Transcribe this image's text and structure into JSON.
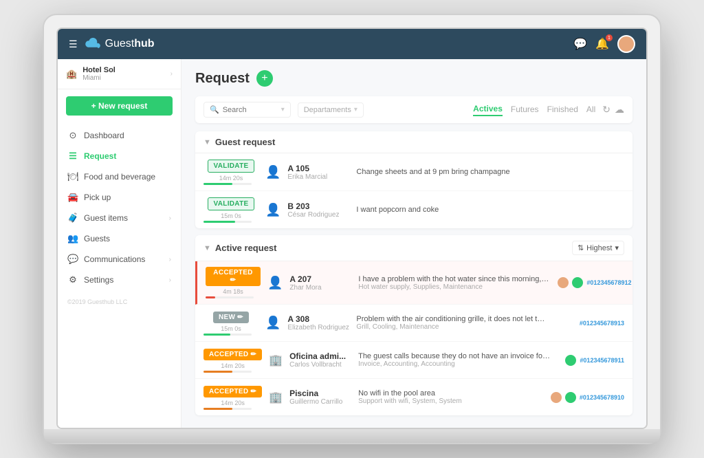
{
  "app": {
    "name": "Guesthub",
    "brand_first": "Guest",
    "brand_second": "hub"
  },
  "hotel": {
    "name": "Hotel Sol",
    "location": "Miami"
  },
  "sidebar": {
    "new_request": "+ New request",
    "nav": [
      {
        "label": "Dashboard",
        "icon": "⊙",
        "active": false,
        "has_chevron": false
      },
      {
        "label": "Request",
        "icon": "☰",
        "active": true,
        "has_chevron": false
      },
      {
        "label": "Food and beverage",
        "icon": "🍽",
        "active": false,
        "has_chevron": false
      },
      {
        "label": "Pick up",
        "icon": "🚗",
        "active": false,
        "has_chevron": false
      },
      {
        "label": "Guest items",
        "icon": "🧳",
        "active": false,
        "has_chevron": true
      },
      {
        "label": "Guests",
        "icon": "👥",
        "active": false,
        "has_chevron": false
      },
      {
        "label": "Communications",
        "icon": "💬",
        "active": false,
        "has_chevron": true
      },
      {
        "label": "Settings",
        "icon": "⚙",
        "active": false,
        "has_chevron": true
      }
    ],
    "footer": "©2019 Guesthub LLC"
  },
  "content": {
    "title": "Request",
    "filter": {
      "search_placeholder": "Search",
      "department_placeholder": "Departaments",
      "tabs": [
        {
          "label": "Actives",
          "active": true
        },
        {
          "label": "Futures",
          "active": false
        },
        {
          "label": "Finished",
          "active": false
        },
        {
          "label": "All",
          "active": false
        }
      ]
    },
    "guest_section": {
      "title": "Guest request",
      "requests": [
        {
          "badge": "VALIDATE",
          "badge_type": "validate",
          "timer": "14m 20s",
          "progress": 60,
          "progress_color": "fill-green",
          "room": "A 105",
          "name": "Erika Marcial",
          "icon_type": "person",
          "description": "Change sheets and at 9 pm bring champagne",
          "sub_desc": ""
        },
        {
          "badge": "VALIDATE",
          "badge_type": "validate",
          "timer": "15m 0s",
          "progress": 65,
          "progress_color": "fill-green",
          "room": "B 203",
          "name": "César Rodriguez",
          "icon_type": "person",
          "description": "I want popcorn and coke",
          "sub_desc": ""
        }
      ]
    },
    "active_section": {
      "title": "Active request",
      "sort_label": "Highest",
      "requests": [
        {
          "badge": "ACCEPTED ✏",
          "badge_type": "accepted",
          "timer": "4m 18s",
          "progress": 20,
          "progress_color": "fill-red",
          "room": "A 207",
          "name": "Zhar Mora",
          "icon_type": "person",
          "description": "I have a problem with the hot water since this morning, it does not com...",
          "sub_desc": "Hot water supply, Supplies, Maintenance",
          "tag": "#012345678912",
          "highlighted": true
        },
        {
          "badge": "NEW ✏",
          "badge_type": "new-badge",
          "timer": "15m 0s",
          "progress": 55,
          "progress_color": "fill-green",
          "room": "A 308",
          "name": "Elizabeth Rodriguez",
          "icon_type": "person",
          "description": "Problem with the air conditioning grille, it does not let the air pass",
          "sub_desc": "Grill, Cooling, Maintenance",
          "tag": "#012345678913",
          "highlighted": false
        },
        {
          "badge": "ACCEPTED ✏",
          "badge_type": "accepted",
          "timer": "14m 20s",
          "progress": 60,
          "progress_color": "fill-orange",
          "room": "Oficina admi...",
          "name": "Carlos Vollbracht",
          "icon_type": "building",
          "description": "The guest calls because they do not have an invoice for some hotel serv...",
          "sub_desc": "Invoice, Accounting, Accounting",
          "tag": "#012345678911",
          "highlighted": false
        },
        {
          "badge": "ACCEPTED ✏",
          "badge_type": "accepted",
          "timer": "14m 20s",
          "progress": 60,
          "progress_color": "fill-orange",
          "room": "Piscina",
          "name": "Guillermo Carrillo",
          "icon_type": "building",
          "description": "No wifi in the pool area",
          "sub_desc": "Support with wifi, System, System",
          "tag": "#012345678910",
          "highlighted": false
        }
      ]
    }
  }
}
